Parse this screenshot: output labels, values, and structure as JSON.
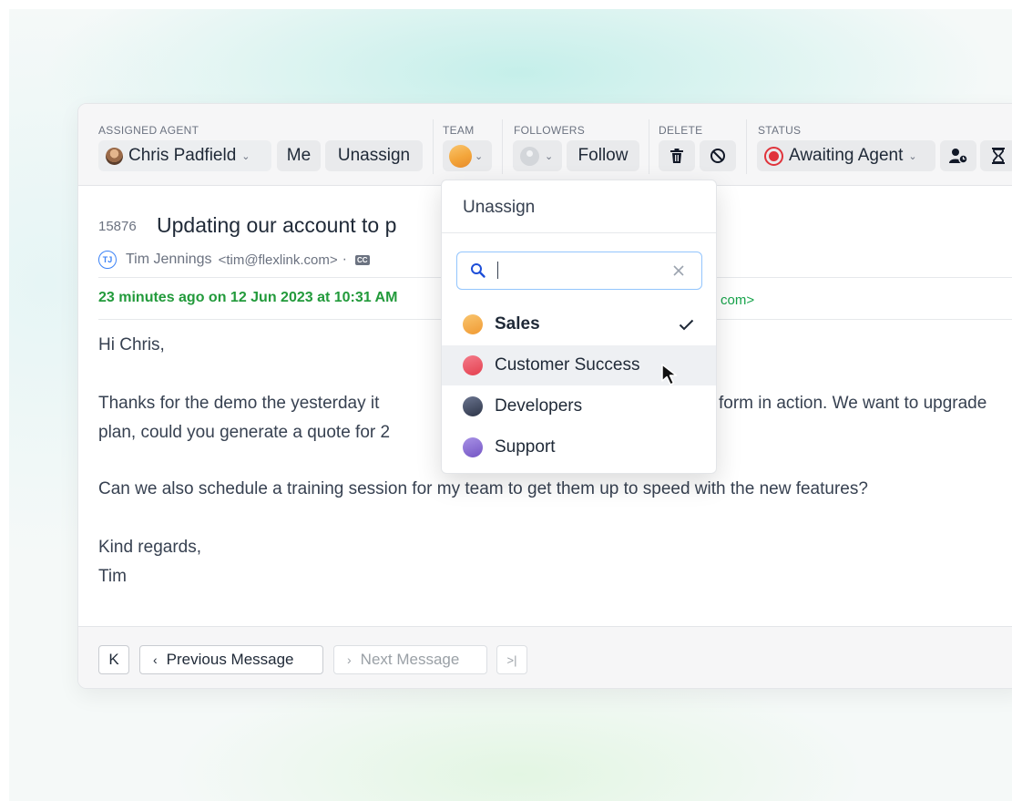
{
  "toolbar": {
    "assigned_agent": {
      "label": "ASSIGNED AGENT",
      "agent_name": "Chris Padfield",
      "me_label": "Me",
      "unassign_label": "Unassign"
    },
    "team": {
      "label": "TEAM",
      "selected_icon": "sales-team-icon"
    },
    "followers": {
      "label": "FOLLOWERS",
      "follow_label": "Follow"
    },
    "delete": {
      "label": "DELETE",
      "icons": [
        "trash-icon",
        "block-icon"
      ]
    },
    "status": {
      "label": "STATUS",
      "value": "Awaiting Agent",
      "icons": [
        "user-clock-icon",
        "hourglass-icon"
      ]
    }
  },
  "ticket": {
    "id": "15876",
    "title": "Updating our account to p",
    "from_initials": "TJ",
    "from_name": "Tim Jennings",
    "from_email": "<tim@flexlink.com>",
    "separator": "·",
    "cc_label": "CC",
    "date_line": "23 minutes ago on 12 Jun 2023 at 10:31 AM",
    "date_tail": "com>",
    "body": {
      "greeting": "Hi Chris,",
      "para1_line1_a": "Thanks for the demo the yesterday it",
      "para1_line1_b": "form in action. We want to upgrade",
      "para1_line2": "plan, could you generate a quote for 2",
      "para2": "Can we also schedule a training session for my team to get them up to speed with the new features?",
      "signoff": "Kind regards,",
      "signature": "Tim"
    }
  },
  "footer": {
    "first_label": "K",
    "prev_label": "Previous Message",
    "next_label": "Next Message",
    "last_label": ">|"
  },
  "team_dropdown": {
    "unassign_label": "Unassign",
    "search_value": "",
    "items": [
      {
        "label": "Sales",
        "color": "#f4b04a",
        "selected": true
      },
      {
        "label": "Customer Success",
        "color": "#ef5a6a",
        "hovered": true
      },
      {
        "label": "Developers",
        "color": "#3f4a63"
      },
      {
        "label": "Support",
        "color": "#8b6fd0"
      }
    ]
  },
  "colors": {
    "accent_green": "#229a3b",
    "status_red": "#e0333b",
    "link_blue": "#3b82f6"
  }
}
